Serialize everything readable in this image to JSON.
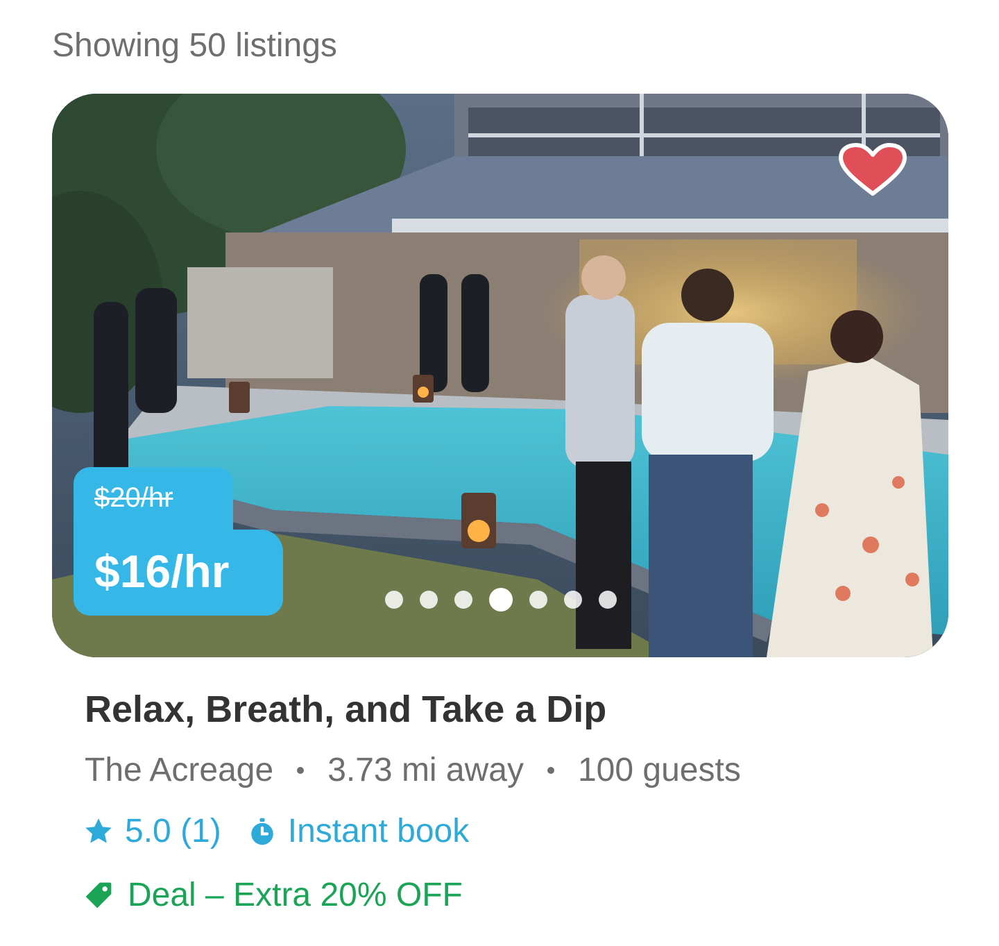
{
  "listings_count_text": "Showing 50 listings",
  "listing": {
    "photo_alt": "Evening pool party at house with lanterns",
    "price_original": "$20/hr",
    "price_current": "$16/hr",
    "carousel": {
      "total": 7,
      "active_index": 3
    },
    "favorited": true,
    "title": "Relax, Breath, and Take a Dip",
    "host": "The Acreage",
    "distance": "3.73 mi away",
    "guests": "100 guests",
    "rating": "5.0 (1)",
    "instant_book": "Instant book",
    "deal": "Deal – Extra 20% OFF"
  },
  "colors": {
    "price_badge": "#35b7e8",
    "heart": "#e04f57",
    "link_blue": "#2eaad9",
    "deal_green": "#1aa456",
    "text_dark": "#333333",
    "text_muted": "#6e6e6e"
  },
  "icons": [
    "heart-icon",
    "star-icon",
    "stopwatch-icon",
    "tag-icon"
  ]
}
